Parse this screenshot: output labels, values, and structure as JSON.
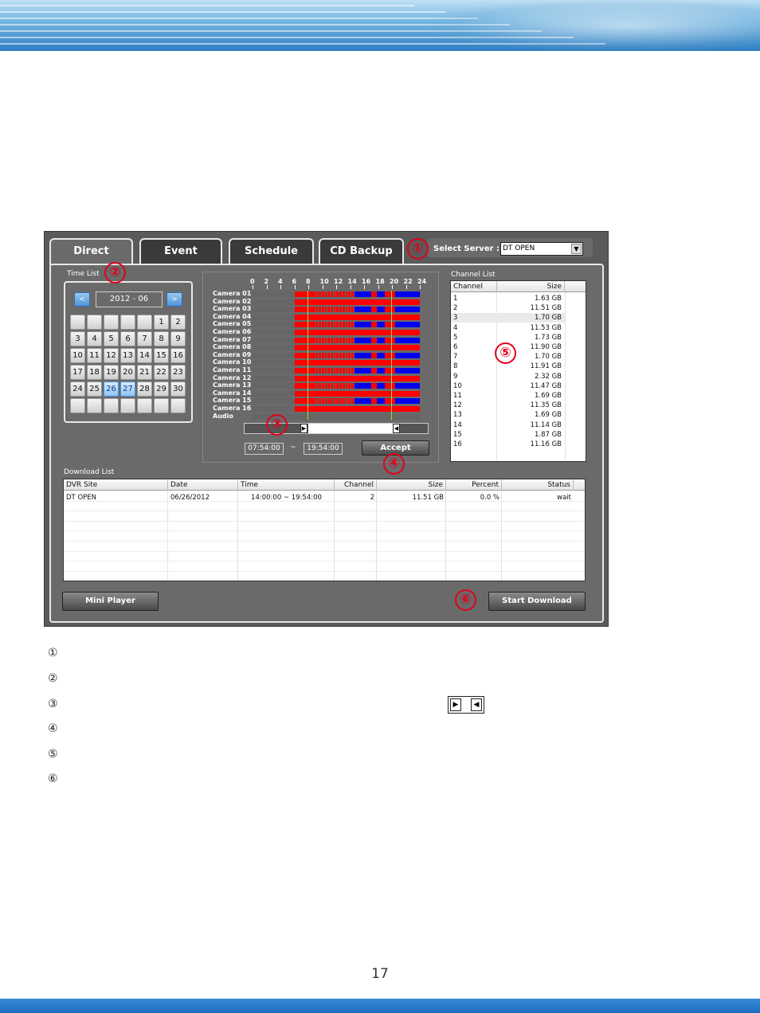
{
  "page_number": "17",
  "window": {
    "tabs": [
      {
        "label": "Direct",
        "active": true
      },
      {
        "label": "Event",
        "active": false
      },
      {
        "label": "Schedule",
        "active": false
      },
      {
        "label": "CD Backup",
        "active": false
      }
    ],
    "server": {
      "label": "Select Server :",
      "value": "DT OPEN"
    },
    "time_list": {
      "label": "Time List",
      "prev": "<",
      "next": ">",
      "month": "2012 - 06",
      "weeks": [
        [
          "",
          "",
          "",
          "",
          "",
          "1",
          "2"
        ],
        [
          "3",
          "4",
          "5",
          "6",
          "7",
          "8",
          "9"
        ],
        [
          "10",
          "11",
          "12",
          "13",
          "14",
          "15",
          "16"
        ],
        [
          "17",
          "18",
          "19",
          "20",
          "21",
          "22",
          "23"
        ],
        [
          "24",
          "25",
          "26",
          "27",
          "28",
          "29",
          "30"
        ],
        [
          "",
          "",
          "",
          "",
          "",
          "",
          ""
        ]
      ],
      "selected_days": [
        "26",
        "27"
      ]
    },
    "timeline": {
      "hours": [
        "0",
        "2",
        "4",
        "6",
        "8",
        "10",
        "12",
        "14",
        "16",
        "18",
        "20",
        "22",
        "24"
      ],
      "cameras": [
        "Camera 01",
        "Camera 02",
        "Camera 03",
        "Camera 04",
        "Camera 05",
        "Camera 06",
        "Camera 07",
        "Camera 08",
        "Camera 09",
        "Camera 10",
        "Camera 11",
        "Camera 12",
        "Camera 13",
        "Camera 14",
        "Camera 15",
        "Camera 16"
      ],
      "audio_label": "Audio",
      "colors": {
        "continuous": "#ff0000",
        "motion": "#0000ee",
        "none": "#666666",
        "marker": "#9bdc3a"
      },
      "start_time": "07:54:00",
      "tilde": "~",
      "end_time": "19:54:00",
      "accept": "Accept"
    },
    "channel_list": {
      "label": "Channel List",
      "columns": [
        "Channel",
        "Size"
      ],
      "rows": [
        [
          "1",
          "1.63 GB"
        ],
        [
          "2",
          "11.51 GB"
        ],
        [
          "3",
          "1.70 GB"
        ],
        [
          "4",
          "11.53 GB"
        ],
        [
          "5",
          "1.73 GB"
        ],
        [
          "6",
          "11.90 GB"
        ],
        [
          "7",
          "1.70 GB"
        ],
        [
          "8",
          "11.91 GB"
        ],
        [
          "9",
          "2.32 GB"
        ],
        [
          "10",
          "11.47 GB"
        ],
        [
          "11",
          "1.69 GB"
        ],
        [
          "12",
          "11.35 GB"
        ],
        [
          "13",
          "1.69 GB"
        ],
        [
          "14",
          "11.14 GB"
        ],
        [
          "15",
          "1.87 GB"
        ],
        [
          "16",
          "11.16 GB"
        ]
      ]
    },
    "download_list": {
      "label": "Download List",
      "columns": [
        "DVR Site",
        "Date",
        "Time",
        "Channel",
        "Size",
        "Percent",
        "Status"
      ],
      "rows": [
        [
          "DT OPEN",
          "06/26/2012",
          "14:00:00 ~ 19:54:00",
          "2",
          "11.51 GB",
          "0.0 %",
          "wait"
        ]
      ]
    },
    "mini_player": "Mini Player",
    "start_download": "Start Download"
  },
  "annotations": [
    "①",
    "②",
    "③",
    "④",
    "⑤",
    "⑥"
  ],
  "legend": [
    "①",
    "②",
    "③",
    "④",
    "⑤",
    "⑥"
  ]
}
